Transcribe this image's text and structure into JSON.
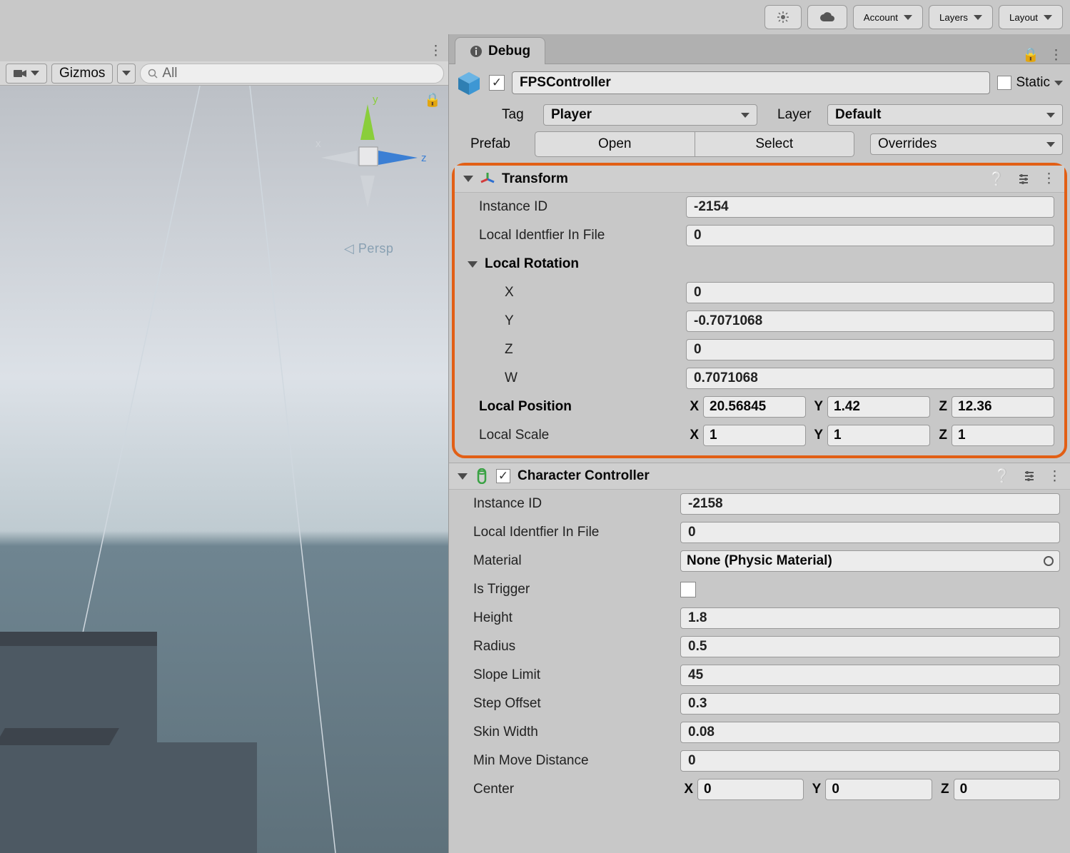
{
  "toolbar": {
    "account": "Account",
    "layers": "Layers",
    "layout": "Layout"
  },
  "scene": {
    "gizmos": "Gizmos",
    "search_placeholder": "All",
    "persp": "Persp",
    "axis_x": "x",
    "axis_y": "y",
    "axis_z": "z"
  },
  "inspector": {
    "tab": "Debug",
    "name": "FPSController",
    "static": "Static",
    "tag_label": "Tag",
    "tag_value": "Player",
    "layer_label": "Layer",
    "layer_value": "Default",
    "prefab_label": "Prefab",
    "prefab_open": "Open",
    "prefab_select": "Select",
    "prefab_overrides": "Overrides"
  },
  "transform": {
    "title": "Transform",
    "instance_id_label": "Instance ID",
    "instance_id": "-2154",
    "local_id_label": "Local Identfier In File",
    "local_id": "0",
    "local_rotation": "Local Rotation",
    "X_label": "X",
    "Y_label": "Y",
    "Z_label": "Z",
    "W_label": "W",
    "rx": "0",
    "ry": "-0.7071068",
    "rz": "0",
    "rw": "0.7071068",
    "local_position": "Local Position",
    "px": "20.56845",
    "py": "1.42",
    "pz": "12.36",
    "local_scale": "Local Scale",
    "sx": "1",
    "sy": "1",
    "sz": "1"
  },
  "cc": {
    "title": "Character Controller",
    "instance_id_label": "Instance ID",
    "instance_id": "-2158",
    "local_id_label": "Local Identfier In File",
    "local_id": "0",
    "material_label": "Material",
    "material_value": "None (Physic Material)",
    "is_trigger_label": "Is Trigger",
    "height_label": "Height",
    "height": "1.8",
    "radius_label": "Radius",
    "radius": "0.5",
    "slope_label": "Slope Limit",
    "slope": "45",
    "step_label": "Step Offset",
    "step": "0.3",
    "skin_label": "Skin Width",
    "skin": "0.08",
    "min_move_label": "Min Move Distance",
    "min_move": "0",
    "center_label": "Center",
    "cx": "0",
    "cy": "0",
    "cz": "0"
  }
}
